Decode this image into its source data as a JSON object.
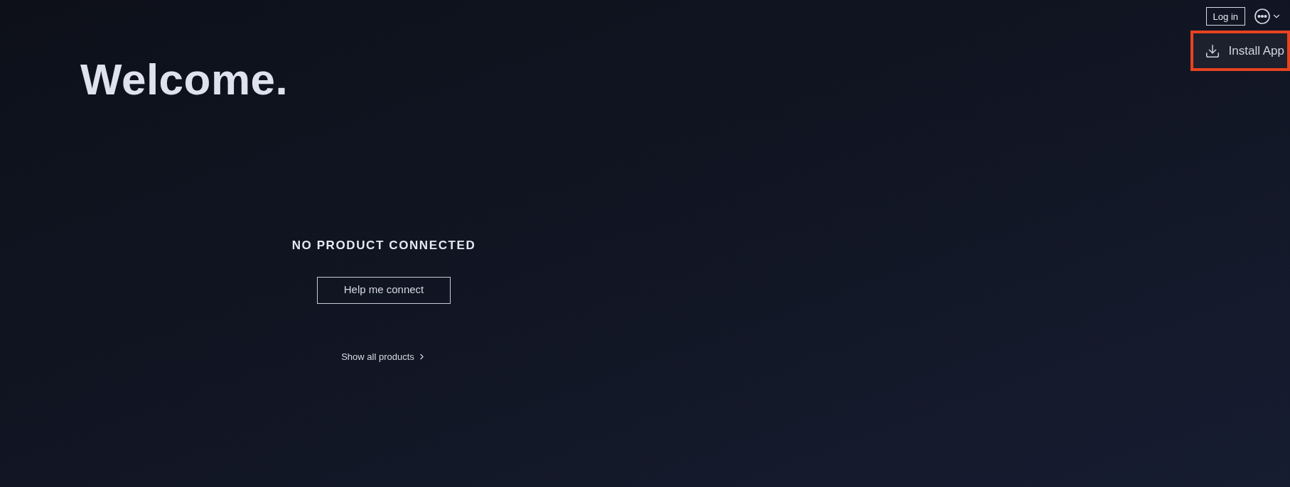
{
  "header": {
    "login_label": "Log in"
  },
  "menu": {
    "items": [
      {
        "label": "Install App",
        "highlighted": true
      }
    ]
  },
  "title": "Welcome.",
  "status": {
    "heading": "NO PRODUCT CONNECTED",
    "button_label": "Help me connect",
    "link_label": "Show all products"
  }
}
